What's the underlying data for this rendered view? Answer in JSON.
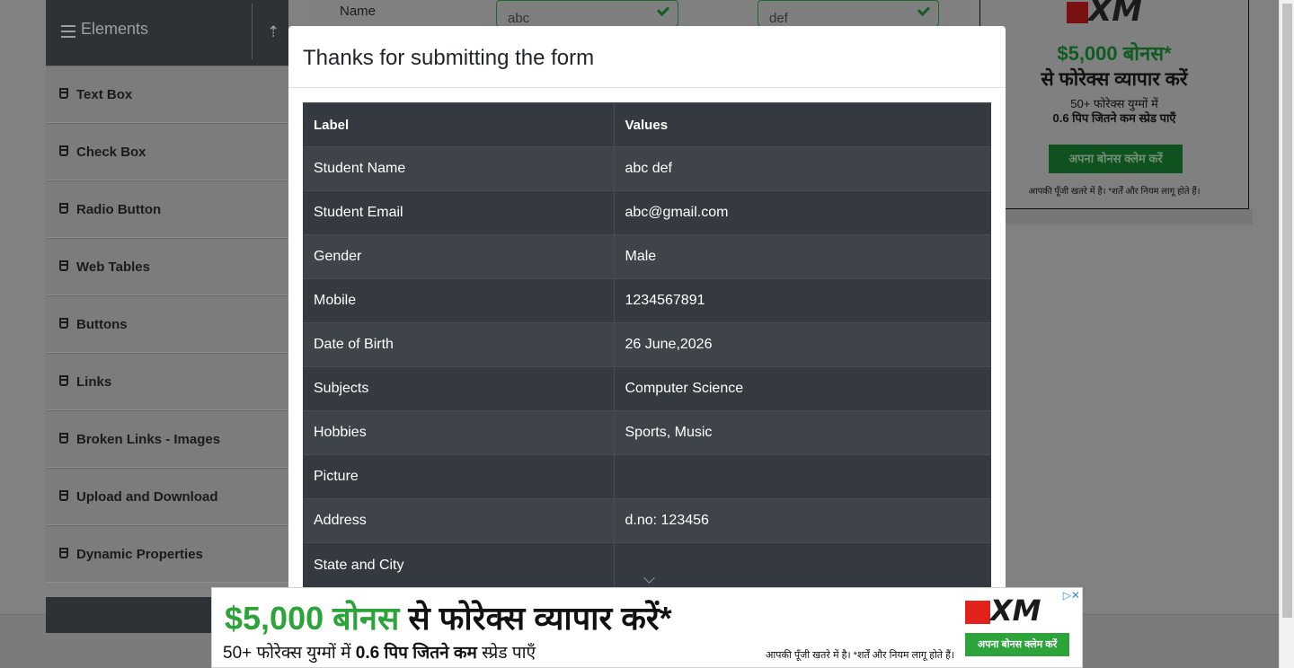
{
  "sidebar": {
    "group_title": "Elements",
    "items": [
      {
        "label": "Text Box"
      },
      {
        "label": "Check Box"
      },
      {
        "label": "Radio Button"
      },
      {
        "label": "Web Tables"
      },
      {
        "label": "Buttons"
      },
      {
        "label": "Links"
      },
      {
        "label": "Broken Links - Images"
      },
      {
        "label": "Upload and Download"
      },
      {
        "label": "Dynamic Properties"
      }
    ]
  },
  "form_bg": {
    "name_label": "Name",
    "first_name": "abc",
    "last_name": "def"
  },
  "side_ad": {
    "brand": "XM",
    "bonus": "$5,000 बोनस*",
    "tagline": "से फोरेक्स व्यापार करें",
    "line1": "50+ फोरेक्स युग्मों में",
    "line2": "0.6 पिप जितने कम स्प्रेड पाएँ",
    "cta": "अपना बोनस क्लेम करें",
    "note": "आपकी पूँजी खतरे में है। *शर्तें और नियम लागू होते हैं।"
  },
  "modal": {
    "title": "Thanks for submitting the form",
    "headers": {
      "label": "Label",
      "values": "Values"
    },
    "rows": [
      {
        "label": "Student Name",
        "value": "abc def"
      },
      {
        "label": "Student Email",
        "value": "abc@gmail.com"
      },
      {
        "label": "Gender",
        "value": "Male"
      },
      {
        "label": "Mobile",
        "value": "1234567891"
      },
      {
        "label": "Date of Birth",
        "value": "26 June,2026"
      },
      {
        "label": "Subjects",
        "value": "Computer Science"
      },
      {
        "label": "Hobbies",
        "value": "Sports, Music"
      },
      {
        "label": "Picture",
        "value": ""
      },
      {
        "label": "Address",
        "value": "d.no: 123456"
      },
      {
        "label": "State and City",
        "value": ""
      }
    ]
  },
  "bottom_ad": {
    "headline_green": "$5,000 बोनस",
    "headline_rest": " से फोरेक्स व्यापार करें*",
    "sub_prefix": "50+ फोरेक्स युग्मों में ",
    "sub_bold": "0.6 पिप जितने कम",
    "sub_suffix": " स्प्रेड पाएँ",
    "disclaimer": "आपकी पूँजी खतरे में है। *शर्तें और नियम लागू होते हैं।",
    "cta": "अपना बोनस क्लेम करें",
    "brand": "XM",
    "adchoice": "▷✕"
  }
}
